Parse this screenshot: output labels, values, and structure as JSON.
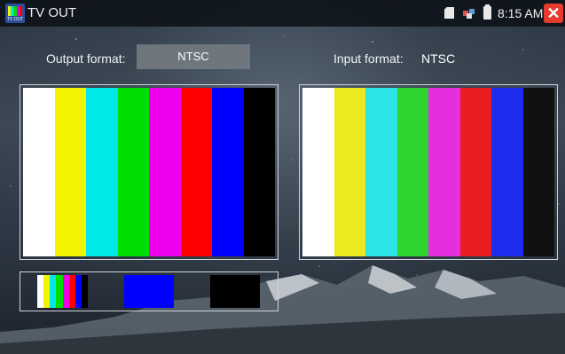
{
  "app": {
    "icon_text": "TV OUT",
    "title": "TV OUT"
  },
  "status": {
    "time": "8:15 AM",
    "close_symbol": "✕",
    "icons": [
      "sd-card-icon",
      "network-icon",
      "battery-icon",
      "close-icon"
    ]
  },
  "output": {
    "label": "Output format:",
    "value": "NTSC"
  },
  "input": {
    "label": "Input format:",
    "value": "NTSC"
  },
  "colors": {
    "output_bars": [
      "#ffffff",
      "#f4f400",
      "#00e8e8",
      "#00dd00",
      "#ee00ee",
      "#ff0000",
      "#0000ff",
      "#000000"
    ],
    "input_bars": [
      "#ffffff",
      "#eaea1e",
      "#2ae4e6",
      "#2ed52e",
      "#e42ee0",
      "#e81e23",
      "#1e2ef0",
      "#111111"
    ],
    "pattern_colorbar": [
      "#ffffff",
      "#f4f400",
      "#00e8e8",
      "#00dd00",
      "#ee00ee",
      "#ff0000",
      "#0000ff",
      "#000000"
    ],
    "pattern_blue": "#0000ff",
    "pattern_black": "#000000",
    "close_button": "#e53a2f"
  },
  "patterns": [
    "colorbar",
    "blue",
    "black"
  ]
}
